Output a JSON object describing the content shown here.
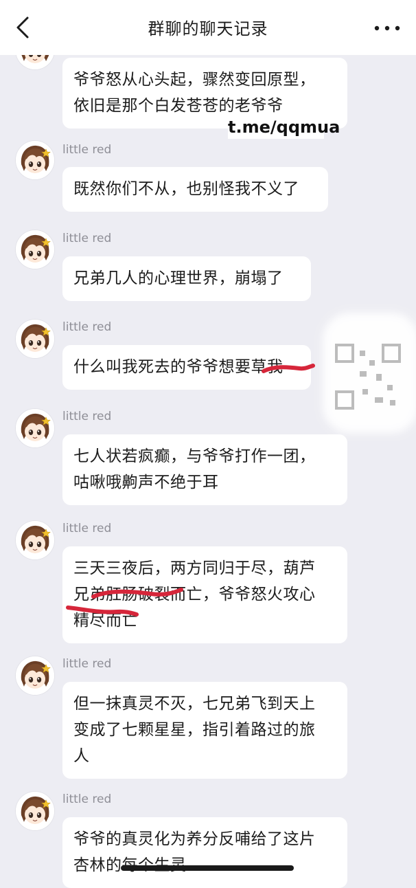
{
  "header": {
    "title": "群聊的聊天记录",
    "back_icon": "chevron-left-icon",
    "more_icon": "more-dots-icon"
  },
  "watermark": "t.me/qqmua",
  "messages": [
    {
      "name": "",
      "lines": [
        "爷爷怒从心头起，骤然变回原型，",
        "依旧是那个白发苍苍的老爷爷"
      ]
    },
    {
      "name": "little red",
      "lines": [
        "既然你们不从，也别怪我不义了"
      ]
    },
    {
      "name": "little red",
      "lines": [
        "兄弟几人的心理世界，崩塌了"
      ]
    },
    {
      "name": "little red",
      "lines": [
        "什么叫我死去的爷爷想要草我"
      ]
    },
    {
      "name": "little red",
      "lines": [
        "七人状若疯癫，与爷爷打作一团，",
        "咕啾哦齁声不绝于耳"
      ]
    },
    {
      "name": "little red",
      "lines": [
        "三天三夜后，两方同归于尽，葫芦",
        "兄弟肛肠破裂而亡，爷爷怒火攻心",
        "精尽而亡"
      ]
    },
    {
      "name": "little red",
      "lines": [
        "但一抹真灵不灭，七兄弟飞到天上",
        "变成了七颗星星，指引着路过的旅",
        "人"
      ]
    },
    {
      "name": "little red",
      "lines": [
        "爷爷的真灵化为养分反哺给了这片",
        "杏林的每个生灵"
      ]
    }
  ],
  "colors": {
    "background": "#ededf3",
    "bubble": "#ffffff",
    "name_text": "#8e8e96",
    "strike": "#d6263a"
  }
}
